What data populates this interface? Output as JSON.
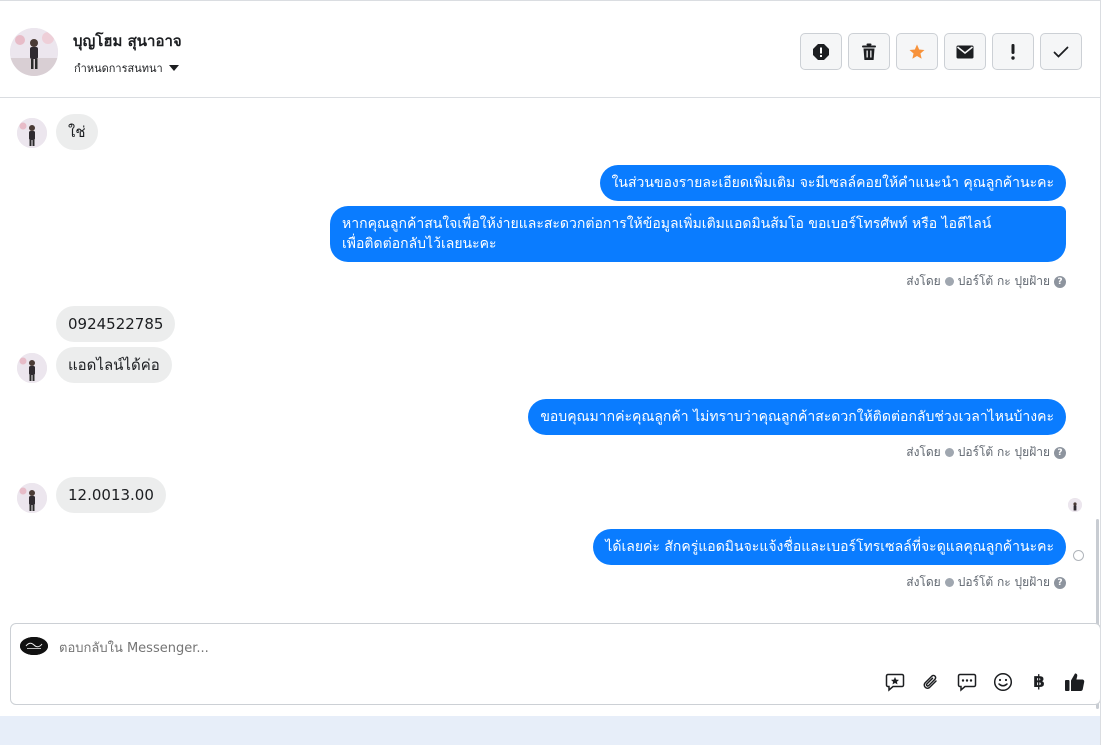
{
  "header": {
    "contact_name": "บุญโฮม สุนาอาจ",
    "assign_label": "กำหนดการสนทนา",
    "actions": [
      {
        "name": "mark-spam-button",
        "icon": "alert-icon"
      },
      {
        "name": "delete-button",
        "icon": "trash-icon"
      },
      {
        "name": "star-button",
        "icon": "star-icon"
      },
      {
        "name": "mark-unread-button",
        "icon": "envelope-icon"
      },
      {
        "name": "follow-up-button",
        "icon": "exclamation-icon"
      },
      {
        "name": "mark-done-button",
        "icon": "check-icon"
      }
    ]
  },
  "messages": {
    "m1_in": "ใช่",
    "m2_out": "ในส่วนของรายละเอียดเพิ่มเติม จะมีเซลล์คอยให้คำแนะนำ คุณลูกค้านะคะ",
    "m3_out_line1": "หากคุณลูกค้าสนใจเพื่อให้ง่ายและสะดวกต่อการให้ข้อมูลเพิ่มเติมแอดมินส้มโอ ขอเบอร์โทรศัพท์ หรือ ไอดีไลน์",
    "m3_out_line2": "เพื่อติดต่อกลับไว้เลยนะคะ",
    "m4_in": "0924522785",
    "m5_in": "แอดไลน์ได้ค่อ",
    "m6_out": "ขอบคุณมากค่ะคุณลูกค้า ไม่ทราบว่าคุณลูกค้าสะดวกให้ติดต่อกลับช่วงเวลาไหนบ้างคะ",
    "m7_in": "12.0013.00",
    "m8_out": "ได้เลยค่ะ สักครู่แอดมินจะแจ้งชื่อและเบอร์โทรเซลล์ที่จะดูแลคุณลูกค้านะคะ"
  },
  "sent_by": {
    "prefix": "ส่งโดย",
    "agent": "ปอร์โต้ กะ ปุยฝ้าย",
    "help": "?"
  },
  "reply": {
    "placeholder": "ตอบกลับใน Messenger...",
    "currency_symbol": "฿",
    "tools": [
      "saved-reply-icon",
      "attachment-icon",
      "chat-bubbles-icon",
      "emoji-icon",
      "baht-icon",
      "thumbs-up-icon"
    ]
  },
  "colors": {
    "outgoing_bubble": "#0a7cff",
    "incoming_bubble": "#eceded",
    "star": "#f7923b"
  }
}
